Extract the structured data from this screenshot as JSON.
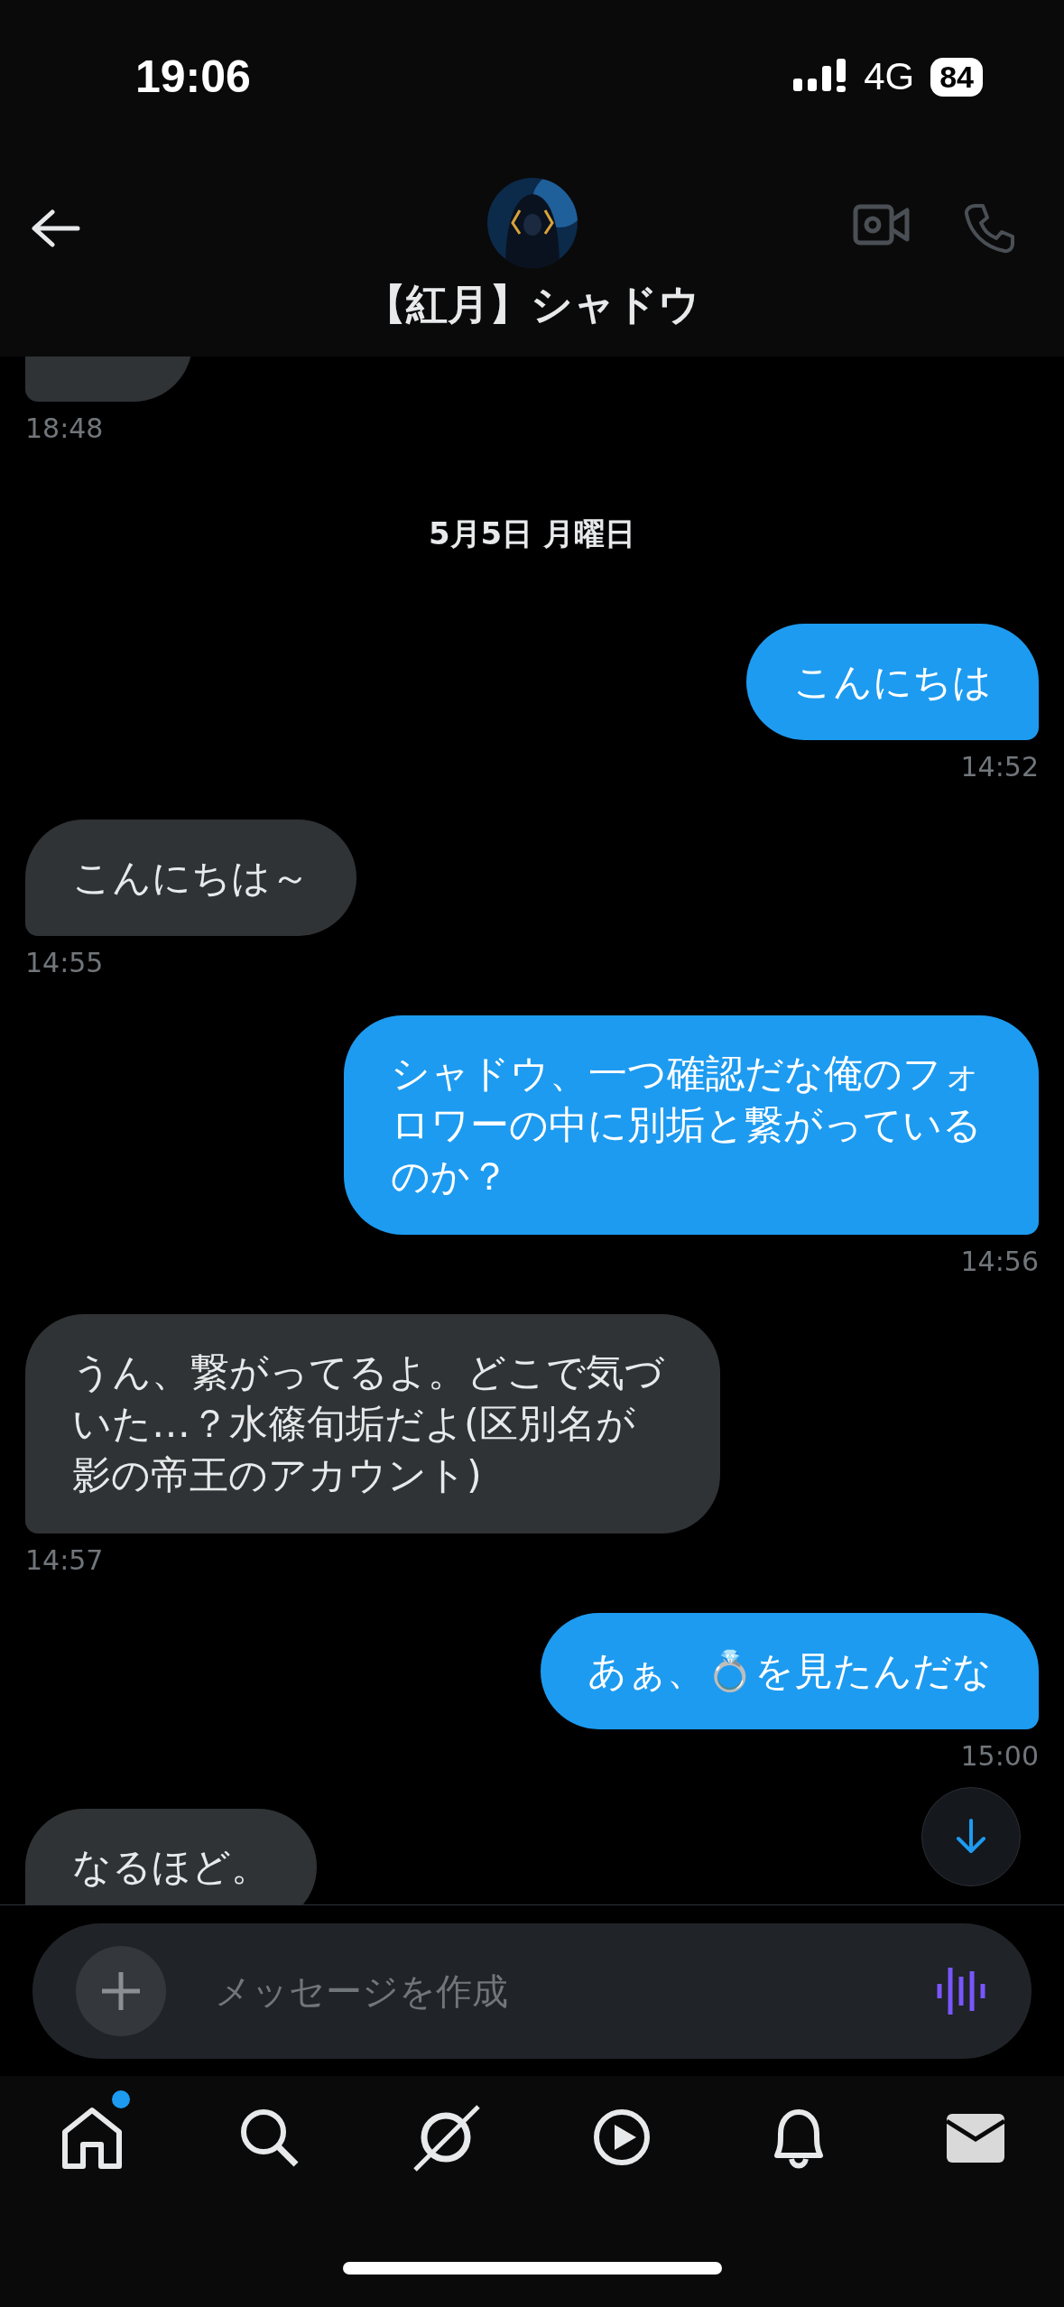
{
  "status_bar": {
    "time": "19:06",
    "network": "4G",
    "battery": "84"
  },
  "header": {
    "title": "【紅月】シャドウ"
  },
  "messages": [
    {
      "kind": "received",
      "time": "18:48"
    },
    {
      "kind": "date",
      "text": "5月5日 月曜日"
    },
    {
      "kind": "sent",
      "text": "こんにちは",
      "time": "14:52"
    },
    {
      "kind": "received",
      "text": "こんにちは～",
      "time": "14:55"
    },
    {
      "kind": "sent",
      "text": "シャドウ、一つ確認だな俺のフォロワーの中に別垢と繋がっているのか？",
      "time": "14:56"
    },
    {
      "kind": "received",
      "text": "うん、繋がってるよ。どこで気づいた…？水篠旬垢だよ(区別名が影の帝王のアカウント)",
      "time": "14:57"
    },
    {
      "kind": "sent",
      "text": "あぁ、💍を見たんだな",
      "time": "15:00"
    },
    {
      "kind": "received",
      "text": "なるほど。"
    }
  ],
  "composer": {
    "placeholder": "メッセージを作成"
  },
  "nav": {
    "notification_dot": true
  }
}
